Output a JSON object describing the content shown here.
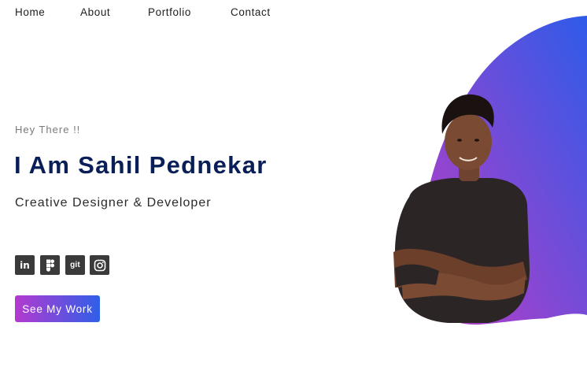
{
  "nav": {
    "items": [
      {
        "label": "Home"
      },
      {
        "label": "About"
      },
      {
        "label": "Portfolio"
      },
      {
        "label": "Contact"
      }
    ]
  },
  "hero": {
    "greeting": "Hey There !!",
    "name": "I Am Sahil Pednekar",
    "role": "Creative Designer & Developer",
    "cta_label": "See My Work"
  },
  "socials": [
    {
      "icon": "linkedin-icon",
      "glyph": "in"
    },
    {
      "icon": "figma-icon",
      "glyph": ""
    },
    {
      "icon": "git-icon",
      "glyph": "git"
    },
    {
      "icon": "instagram-icon",
      "glyph": ""
    }
  ],
  "colors": {
    "name": "#0a1f57",
    "gradient_start": "#c23bc4",
    "gradient_end": "#2e5be9",
    "icon_bg": "#3a3a3a"
  }
}
